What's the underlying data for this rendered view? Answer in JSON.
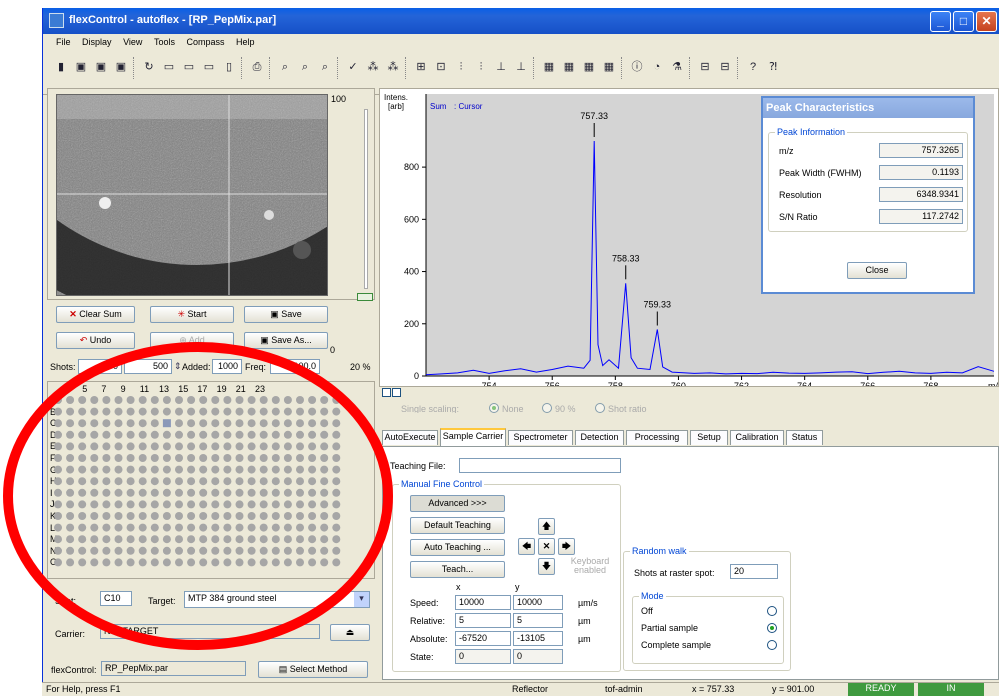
{
  "window": {
    "title": "flexControl - autoflex - [RP_PepMix.par]"
  },
  "menu": [
    "File",
    "Display",
    "View",
    "Tools",
    "Compass",
    "Help"
  ],
  "video": {
    "scale_top": "100",
    "scale_bottom": "0"
  },
  "buttons": {
    "clear_sum": "Clear Sum",
    "start": "Start",
    "save": "Save",
    "undo": "Undo",
    "add": "Add",
    "save_as": "Save As...",
    "select_method": "Select Method"
  },
  "shots": {
    "label": "Shots:",
    "value": "500",
    "step": "500",
    "added_label": "Added:",
    "added": "1000",
    "freq_label": "Freq:",
    "freq": "100.0",
    "pct": "20 %"
  },
  "plate": {
    "col_labels": [
      "3",
      "5",
      "7",
      "9",
      "11",
      "13",
      "15",
      "17",
      "19",
      "21",
      "23"
    ],
    "row_labels": [
      "A",
      "B",
      "C",
      "D",
      "E",
      "F",
      "G",
      "H",
      "I",
      "J",
      "K",
      "L",
      "M",
      "N",
      "O"
    ]
  },
  "bottom_left": {
    "spot_label": "Spot:",
    "spot_value": "C10",
    "target_label": "Target:",
    "target_value": "MTP 384 ground steel",
    "carrier_label": "Carrier:",
    "carrier_value": "NO_TARGET",
    "flex_label": "flexControl:",
    "flex_value": "RP_PepMix.par"
  },
  "chart_data": {
    "type": "line",
    "ylabel": "Intens. [arb]",
    "legend": [
      "Sum",
      ": Cursor"
    ],
    "xlabel": "m/z",
    "xlim": [
      752.0,
      770.0
    ],
    "ylim": [
      0,
      1000
    ],
    "x_ticks": [
      754,
      756,
      758,
      760,
      762,
      764,
      766,
      768
    ],
    "y_ticks": [
      0,
      200,
      400,
      600,
      800
    ],
    "peaks": [
      {
        "label": "757.33",
        "x": 757.33,
        "y": 900
      },
      {
        "label": "758.33",
        "x": 758.33,
        "y": 355
      },
      {
        "label": "759.33",
        "x": 759.33,
        "y": 178
      }
    ],
    "x": [
      752.0,
      752.5,
      753.0,
      753.5,
      754.0,
      754.5,
      755.0,
      755.5,
      756.0,
      756.5,
      757.0,
      757.2,
      757.33,
      757.45,
      757.6,
      757.8,
      758.1,
      758.33,
      758.5,
      758.7,
      759.1,
      759.33,
      759.5,
      759.8,
      760.5,
      761.0,
      761.5,
      762.0,
      762.5,
      763.0,
      763.5,
      764.0,
      764.5,
      765.0,
      765.5,
      766.0,
      766.5,
      767.0,
      767.5,
      768.0,
      768.5,
      769.0,
      769.5,
      770.0
    ],
    "y": [
      5,
      8,
      12,
      22,
      10,
      20,
      28,
      15,
      25,
      38,
      30,
      60,
      900,
      120,
      40,
      62,
      30,
      355,
      70,
      30,
      25,
      178,
      35,
      15,
      10,
      12,
      8,
      10,
      9,
      14,
      11,
      10,
      12,
      15,
      16,
      9,
      14,
      18,
      12,
      10,
      14,
      12,
      36,
      18
    ]
  },
  "scaling": {
    "label": "Single scaling:",
    "none": "None",
    "p90": "90 %",
    "shot_ratio": "Shot ratio"
  },
  "peak_info": {
    "title": "Peak Characteristics",
    "group": "Peak Information",
    "rows": [
      {
        "k": "m/z",
        "v": "757.3265"
      },
      {
        "k": "Peak Width (FWHM)",
        "v": "0.1193"
      },
      {
        "k": "Resolution",
        "v": "6348.9341"
      },
      {
        "k": "S/N Ratio",
        "v": "117.2742"
      }
    ],
    "close": "Close"
  },
  "tabs": [
    "AutoExecute",
    "Sample Carrier",
    "Spectrometer",
    "Detection",
    "Processing",
    "Setup",
    "Calibration",
    "Status"
  ],
  "sample": {
    "teaching_label": "Teaching File:",
    "manual": "Manual Fine Control",
    "advanced": "Advanced >>>",
    "default_teaching": "Default Teaching",
    "auto_teaching": "Auto Teaching ...",
    "teach": "Teach...",
    "keyboard": "Keyboard enabled",
    "x": "x",
    "y": "y",
    "speed_label": "Speed:",
    "speed_x": "10000",
    "speed_y": "10000",
    "speed_unit": "µm/s",
    "relative_label": "Relative:",
    "rel_x": "5",
    "rel_y": "5",
    "rel_unit": "µm",
    "absolute_label": "Absolute:",
    "abs_x": "-67520",
    "abs_y": "-13105",
    "abs_unit": "µm",
    "state_label": "State:",
    "state_x": "0",
    "state_y": "0",
    "random_walk": "Random walk",
    "shots_raster": "Shots at raster spot:",
    "shots_raster_val": "20",
    "mode": "Mode",
    "off": "Off",
    "partial": "Partial sample",
    "complete": "Complete sample"
  },
  "statusbar": {
    "help": "For Help, press F1",
    "mode": "Reflector",
    "user": "tof-admin",
    "x": "x = 757.33",
    "y": "y = 901.00",
    "ready": "READY",
    "in": "IN"
  }
}
